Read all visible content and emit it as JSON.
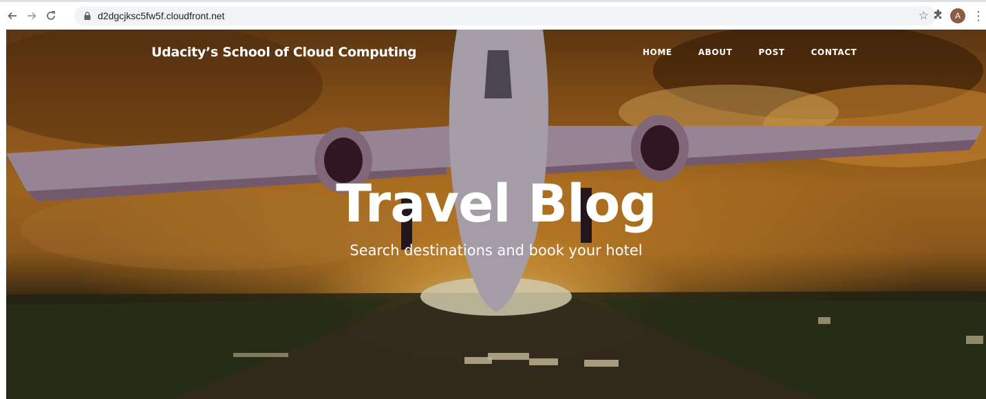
{
  "browser": {
    "url": "d2dgcjksc5fw5f.cloudfront.net",
    "profile_initial": "A",
    "icons": [
      "back-arrow-icon",
      "forward-arrow-icon",
      "reload-icon",
      "lock-icon",
      "star-icon",
      "puzzle-icon",
      "menu-dots-icon"
    ]
  },
  "site": {
    "brand": "Udacity’s School of Cloud Computing",
    "nav": [
      {
        "label": "HOME"
      },
      {
        "label": "ABOUT"
      },
      {
        "label": "POST"
      },
      {
        "label": "CONTACT"
      }
    ],
    "hero": {
      "title": "Travel Blog",
      "subtitle": "Search destinations and book your hotel"
    }
  },
  "colors": {
    "hero_sky": "#c07a25",
    "hero_glow": "#ffe9b0",
    "text": "#ffffff",
    "avatar": "#8d5a45"
  }
}
